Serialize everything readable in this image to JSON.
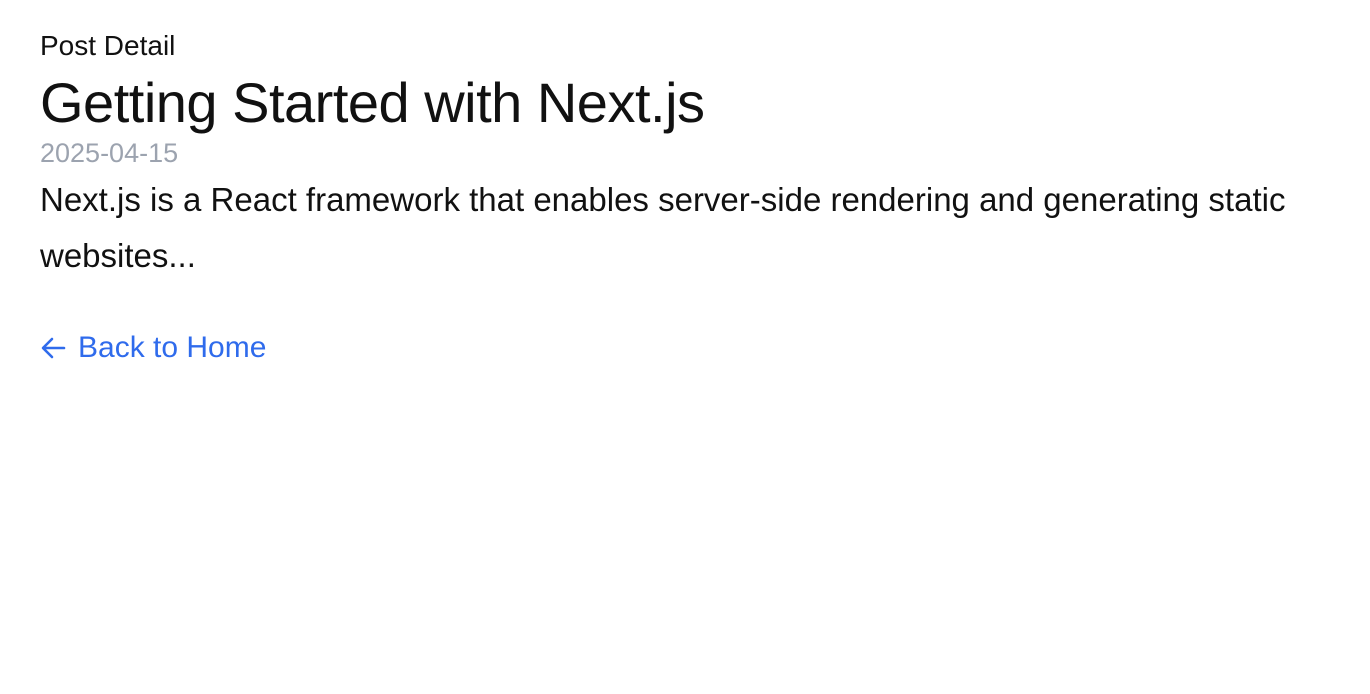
{
  "page": {
    "section_label": "Post Detail"
  },
  "post": {
    "title": "Getting Started with Next.js",
    "date": "2025-04-15",
    "excerpt": "Next.js is a React framework that enables server-side rendering and generating static websites..."
  },
  "navigation": {
    "back_label": "Back to Home",
    "back_icon": "arrow-left-icon"
  },
  "colors": {
    "link": "#2f6bec",
    "muted_text": "#9ca3af",
    "text": "#111111"
  }
}
